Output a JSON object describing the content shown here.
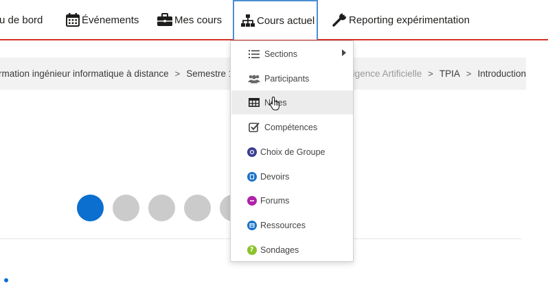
{
  "nav": {
    "dashboard": "u de bord",
    "events": "Événements",
    "my_courses": "Mes cours",
    "current_course": "Cours actuel",
    "reporting": "Reporting expérimentation"
  },
  "breadcrumb": {
    "items": [
      "rmation ingénieur informatique à distance",
      "Semestre 1",
      "lligence Artificielle",
      "TPIA",
      "Introduction"
    ],
    "separator": ">"
  },
  "dropdown": {
    "items": [
      {
        "label": "Sections",
        "icon": "list-ol-icon"
      },
      {
        "label": "Participants",
        "icon": "users-icon"
      },
      {
        "label": "Notes",
        "icon": "table-icon"
      },
      {
        "label": "Compétences",
        "icon": "checkbox-icon"
      },
      {
        "label": "Choix de Groupe",
        "icon": "choice-icon"
      },
      {
        "label": "Devoirs",
        "icon": "assign-icon"
      },
      {
        "label": "Forums",
        "icon": "forum-icon"
      },
      {
        "label": "Ressources",
        "icon": "resource-icon"
      },
      {
        "label": "Sondages",
        "icon": "survey-icon"
      }
    ],
    "hovered": "Notes"
  },
  "progress": {
    "total_visible": 6,
    "current_index": 0
  },
  "colors": {
    "accent_red": "#d63024",
    "active_blue": "#0b6fcf",
    "active_border": "#4a8ed1",
    "choice": "#3a3f8f",
    "assign": "#1a73c9",
    "forum": "#b022a8",
    "resource": "#1a73c9",
    "survey": "#8bc22a"
  }
}
